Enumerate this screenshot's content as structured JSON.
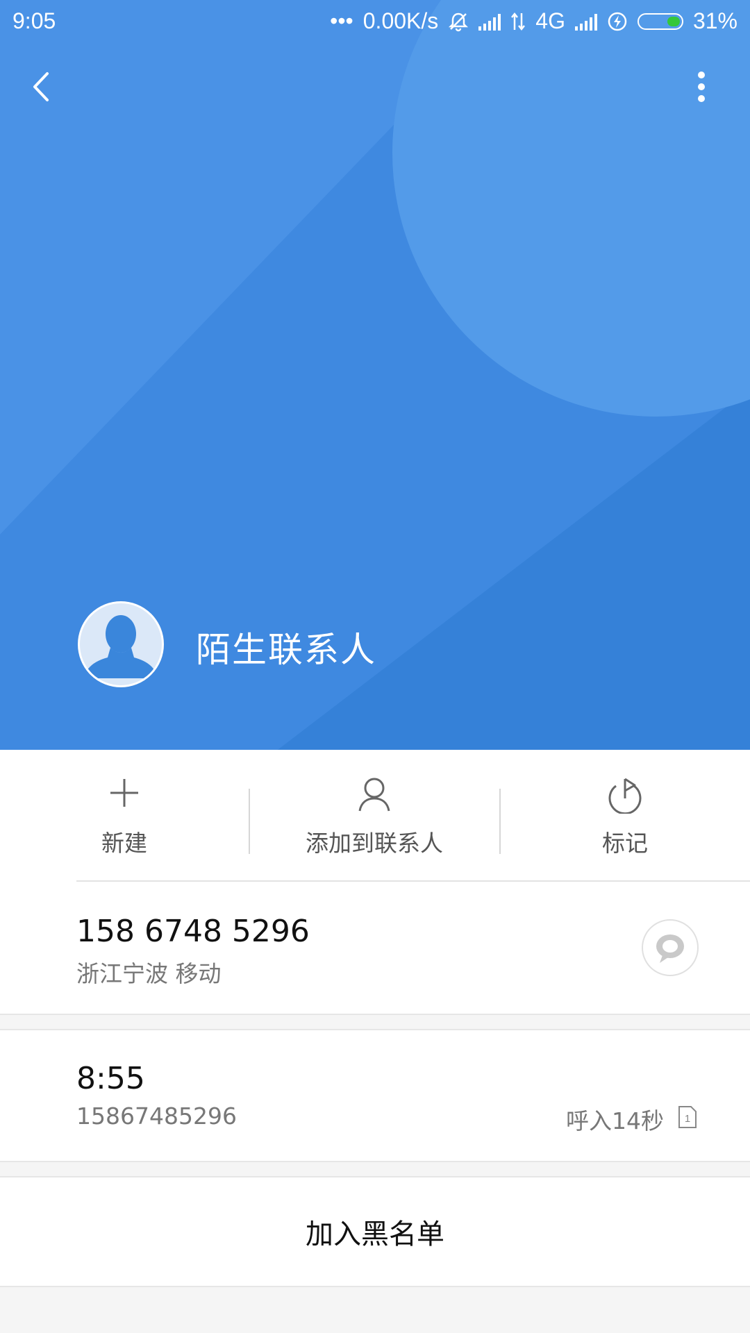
{
  "status_bar": {
    "time": "9:05",
    "dots": "•••",
    "net_speed": "0.00K/s",
    "network_type": "4G",
    "battery_percent": "31%",
    "battery_level": 0.31,
    "icons": [
      "mute-bell-icon",
      "signal-icon",
      "data-arrows-icon",
      "signal-icon",
      "charging-icon",
      "battery-icon"
    ]
  },
  "header": {
    "background_color": "#3a86db",
    "contact_name": "陌生联系人",
    "icons": [
      "back-arrow-icon",
      "more-vertical-icon",
      "avatar-silhouette-icon"
    ]
  },
  "actions": [
    {
      "label": "新建",
      "icon": "plus-icon"
    },
    {
      "label": "添加到联系人",
      "icon": "person-icon"
    },
    {
      "label": "标记",
      "icon": "flag-icon"
    }
  ],
  "number": {
    "phone": "158 6748 5296",
    "location": "浙江宁波 移动",
    "message_icon": "message-bubble-icon"
  },
  "call_log": {
    "time": "8:55",
    "number": "15867485296",
    "detail": "呼入14秒",
    "sim_label": "1"
  },
  "blacklist_label": "加入黑名单"
}
